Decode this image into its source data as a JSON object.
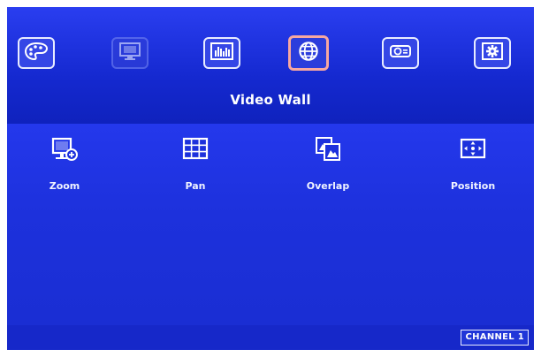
{
  "menu": {
    "title": "Video Wall",
    "tabs": [
      {
        "name": "palette-icon",
        "state": "normal"
      },
      {
        "name": "monitor-icon",
        "state": "dim"
      },
      {
        "name": "equalizer-icon",
        "state": "normal"
      },
      {
        "name": "globe-icon",
        "state": "selected"
      },
      {
        "name": "projector-icon",
        "state": "normal"
      },
      {
        "name": "gear-icon",
        "state": "normal"
      }
    ]
  },
  "submenu": {
    "items": [
      {
        "label": "Zoom",
        "icon": "zoom-icon"
      },
      {
        "label": "Pan",
        "icon": "pan-grid-icon"
      },
      {
        "label": "Overlap",
        "icon": "overlap-icon"
      },
      {
        "label": "Position",
        "icon": "position-icon"
      }
    ]
  },
  "status": {
    "channel": "CHANNEL 1"
  },
  "colors": {
    "background": "#1f33d6",
    "selected_border": "#f7a7a0"
  }
}
